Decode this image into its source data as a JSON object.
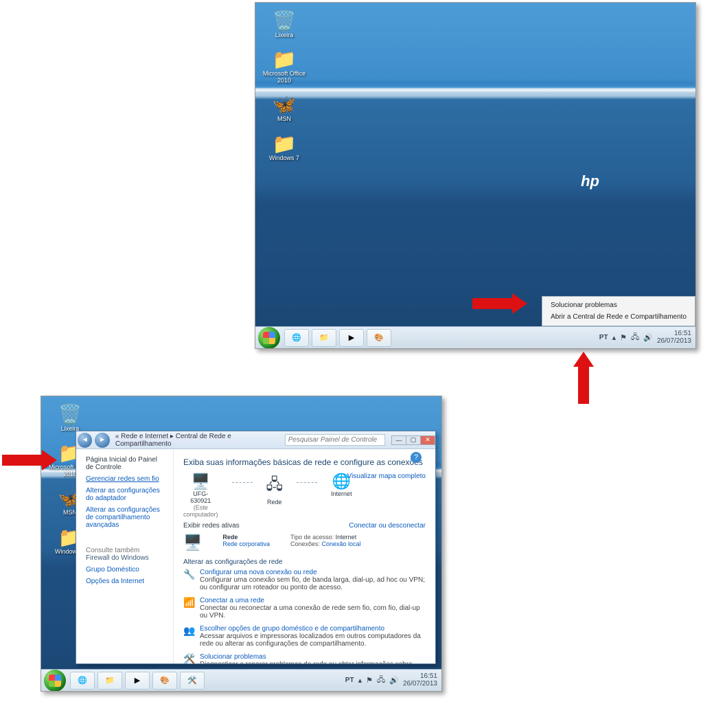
{
  "desktop": {
    "icons": [
      {
        "name": "lixeira",
        "label": "Lixeira",
        "glyph": "🗑️"
      },
      {
        "name": "office-2010",
        "label": "Microsoft Office 2010",
        "glyph": "📁"
      },
      {
        "name": "msn",
        "label": "MSN",
        "glyph": "🦋"
      },
      {
        "name": "windows-7",
        "label": "Windows 7",
        "glyph": "📁"
      }
    ],
    "context_menu": {
      "items": [
        "Solucionar problemas",
        "Abrir a Central de Rede e Compartilhamento"
      ]
    },
    "taskbar": {
      "lang": "PT",
      "time": "16:51",
      "date": "26/07/2013"
    }
  },
  "control_panel": {
    "breadcrumb": "« Rede e Internet ▸ Central de Rede e Compartilhamento",
    "search_placeholder": "Pesquisar Painel de Controle",
    "sidebar": {
      "header": "Página Inicial do Painel de Controle",
      "links": [
        "Gerenciar redes sem fio",
        "Alterar as configurações do adaptador",
        "Alterar as configurações de compartilhamento avançadas"
      ],
      "see_also": "Consulte também",
      "see_links": [
        "Firewall do Windows",
        "Grupo Doméstico",
        "Opções da Internet"
      ]
    },
    "main": {
      "title": "Exiba suas informações básicas de rede e configure as conexões",
      "map_link": "Visualizar mapa completo",
      "nodes": {
        "pc": {
          "label": "UFG-630921",
          "sub": "(Este computador)"
        },
        "net": {
          "label": "Rede"
        },
        "inet": {
          "label": "Internet"
        }
      },
      "active_hdr": "Exibir redes ativas",
      "active_link": "Conectar ou desconectar",
      "active": {
        "name": "Rede",
        "type": "Rede corporativa",
        "access_lbl": "Tipo de acesso:",
        "access_val": "Internet",
        "conn_lbl": "Conexões:",
        "conn_val": "Conexão local"
      },
      "change_hdr": "Alterar as configurações de rede",
      "tasks": [
        {
          "icon": "🔧",
          "title": "Configurar uma nova conexão ou rede",
          "desc": "Configurar uma conexão sem fio, de banda larga, dial-up, ad hoc ou VPN; ou configurar um roteador ou ponto de acesso."
        },
        {
          "icon": "📶",
          "title": "Conectar a uma rede",
          "desc": "Conectar ou reconectar a uma conexão de rede sem fio, com fio, dial-up ou VPN."
        },
        {
          "icon": "👥",
          "title": "Escolher opções de grupo doméstico e de compartilhamento",
          "desc": "Acessar arquivos e impressoras localizados em outros computadores da rede ou alterar as configurações de compartilhamento."
        },
        {
          "icon": "🛠️",
          "title": "Solucionar problemas",
          "desc": "Diagnosticar e reparar problemas de rede ou obter informações sobre como solucionar problemas."
        }
      ]
    },
    "taskbar": {
      "lang": "PT",
      "time": "16:51",
      "date": "26/07/2013"
    }
  }
}
